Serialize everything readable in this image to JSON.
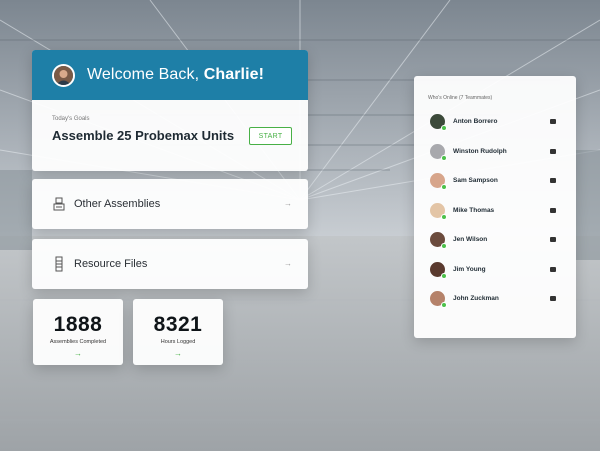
{
  "welcome": {
    "greeting": "Welcome Back,",
    "name": "Charlie!"
  },
  "goals": {
    "label": "Today's Goals",
    "goal": "Assemble 25 Probemax Units",
    "start_label": "START"
  },
  "other_assemblies": {
    "label": "Other Assemblies"
  },
  "resource_files": {
    "label": "Resource Files"
  },
  "stats": [
    {
      "value": "1888",
      "caption": "Assemblies Completed"
    },
    {
      "value": "8321",
      "caption": "Hours Logged"
    }
  ],
  "online": {
    "title": "Who's Online (7 Teammates)",
    "members": [
      {
        "name": "Anton Borrero",
        "color": "#3c4a3a"
      },
      {
        "name": "Winston Rudolph",
        "color": "#a8a9ad"
      },
      {
        "name": "Sam Sampson",
        "color": "#d7a58b"
      },
      {
        "name": "Mike Thomas",
        "color": "#e3c5a6"
      },
      {
        "name": "Jen Wilson",
        "color": "#6b4b3d"
      },
      {
        "name": "Jim Young",
        "color": "#5a3a2e"
      },
      {
        "name": "John Zuckman",
        "color": "#b5826a"
      }
    ]
  },
  "colors": {
    "accent": "#1e7fa7",
    "success": "#48b046",
    "online": "#4cc14a"
  }
}
